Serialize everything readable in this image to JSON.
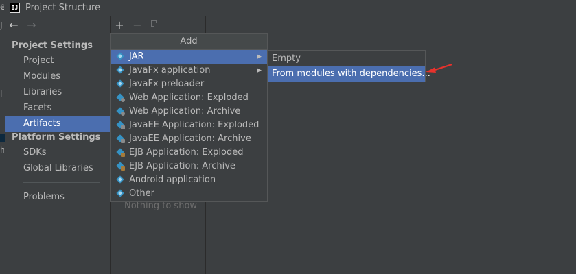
{
  "window": {
    "title": "Project Structure",
    "app_icon_text": "IJ"
  },
  "nav_toolbar": {
    "back_glyph": "←",
    "forward_glyph": "→"
  },
  "sidebar": {
    "project_settings_header": "Project Settings",
    "project_settings_items": [
      {
        "label": "Project"
      },
      {
        "label": "Modules"
      },
      {
        "label": "Libraries"
      },
      {
        "label": "Facets"
      },
      {
        "label": "Artifacts",
        "selected": true
      }
    ],
    "platform_settings_header": "Platform Settings",
    "platform_settings_items": [
      {
        "label": "SDKs"
      },
      {
        "label": "Global Libraries"
      }
    ],
    "problems_label": "Problems"
  },
  "artifacts_toolbar": {
    "add_glyph": "+",
    "remove_glyph": "−"
  },
  "artifacts_panel": {
    "empty_text": "Nothing to show"
  },
  "add_menu": {
    "title": "Add",
    "items": [
      {
        "label": "JAR",
        "icon": "artifact-diamond-icon",
        "has_submenu": true,
        "active": true
      },
      {
        "label": "JavaFx application",
        "icon": "artifact-diamond-icon",
        "has_submenu": true
      },
      {
        "label": "JavaFx preloader",
        "icon": "artifact-diamond-icon"
      },
      {
        "label": "Web Application: Exploded",
        "icon": "web-artifact-icon"
      },
      {
        "label": "Web Application: Archive",
        "icon": "web-artifact-icon"
      },
      {
        "label": "JavaEE Application: Exploded",
        "icon": "javaee-artifact-icon"
      },
      {
        "label": "JavaEE Application: Archive",
        "icon": "javaee-artifact-icon"
      },
      {
        "label": "EJB Application: Exploded",
        "icon": "ejb-artifact-icon"
      },
      {
        "label": "EJB Application: Archive",
        "icon": "ejb-artifact-icon"
      },
      {
        "label": "Android application",
        "icon": "artifact-diamond-icon"
      },
      {
        "label": "Other",
        "icon": "artifact-diamond-icon"
      }
    ],
    "submenu_arrow": "▶"
  },
  "jar_submenu": {
    "items": [
      {
        "label": "Empty"
      },
      {
        "label": "From modules with dependencies...",
        "active": true
      }
    ]
  },
  "colors": {
    "background": "#3c3f41",
    "selection": "#4b6eaf",
    "annotation_arrow": "#e8322c",
    "icon_blue": "#3592c4"
  }
}
